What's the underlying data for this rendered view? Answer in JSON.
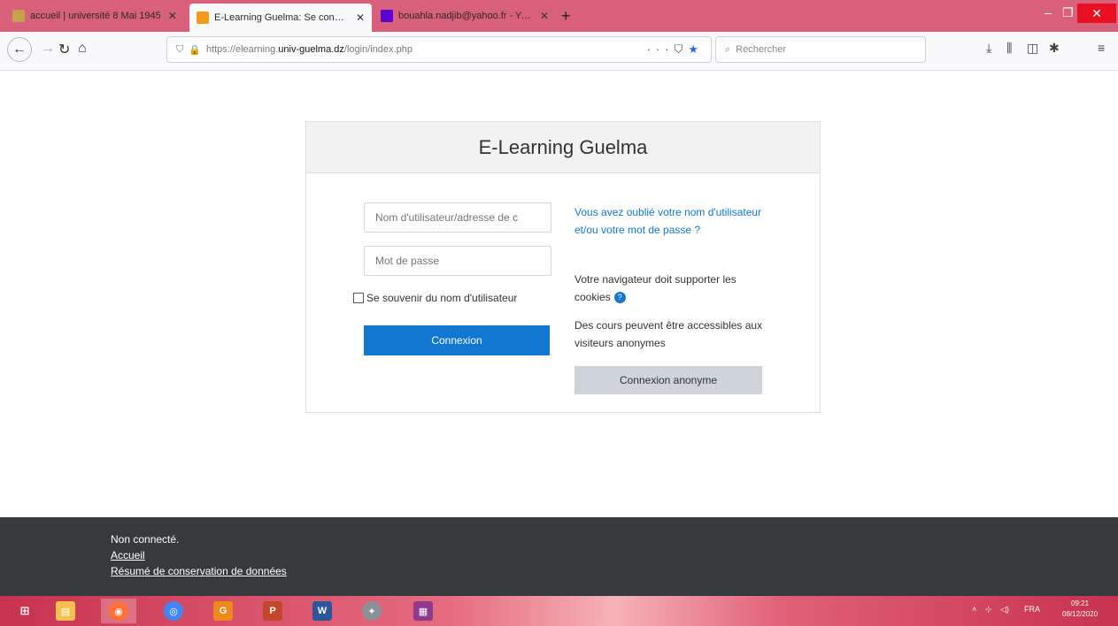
{
  "browser": {
    "tabs": [
      {
        "title": "accueil | université 8 Mai 1945",
        "favicon_color": "#c6a24a",
        "active": false
      },
      {
        "title": "E-Learning Guelma: Se connecter",
        "favicon_color": "#f39a1c",
        "active": true
      },
      {
        "title": "bouahla.nadjib@yahoo.fr - Yahoo",
        "favicon_color": "#5f01d1",
        "active": false
      }
    ],
    "new_tab": "+",
    "url_prefix": "https://elearning.",
    "url_host": "univ-guelma.dz",
    "url_path": "/login/index.php",
    "search_placeholder": "Rechercher",
    "window_controls": {
      "minimize": "–",
      "maximize": "❐",
      "close": "✕"
    }
  },
  "card": {
    "title": "E-Learning Guelma",
    "username_placeholder": "Nom d'utilisateur/adresse de c",
    "password_placeholder": "Mot de passe",
    "remember_label": "Se souvenir du nom d'utilisateur",
    "login_button": "Connexion",
    "forgot_link": "Vous avez oublié votre nom d'utilisateur et/ou votre mot de passe ?",
    "cookies_text": "Votre navigateur doit supporter les cookies",
    "guest_text": "Des cours peuvent être accessibles aux visiteurs anonymes",
    "guest_button": "Connexion anonyme"
  },
  "footer": {
    "status": "Non connecté.",
    "home_link": "Accueil",
    "data_retention_link": "Résumé de conservation de données"
  },
  "taskbar": {
    "language": "FRA",
    "time": "09:21",
    "date": "08/12/2020"
  }
}
